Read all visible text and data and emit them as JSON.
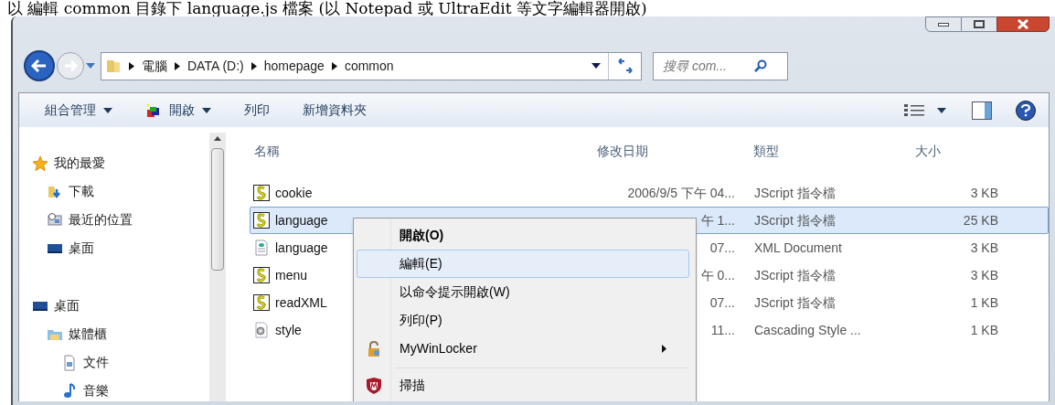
{
  "caption": "以 編輯 common 目錄下 language.js 檔案 (以 Notepad 或 UltraEdit 等文字編輯器開啟)",
  "breadcrumb": [
    "電腦",
    "DATA (D:)",
    "homepage",
    "common"
  ],
  "search": {
    "placeholder": "搜尋 com..."
  },
  "toolbar": [
    {
      "label": "組合管理",
      "dropdown": true,
      "kind": "plain"
    },
    {
      "label": "開啟",
      "dropdown": true,
      "kind": "open"
    },
    {
      "label": "列印",
      "dropdown": false,
      "kind": "plain"
    },
    {
      "label": "新增資料夾",
      "dropdown": false,
      "kind": "plain"
    }
  ],
  "nav": [
    {
      "label": "我的最愛",
      "kind": "star",
      "children": [
        {
          "label": "下載",
          "kind": "download"
        },
        {
          "label": "最近的位置",
          "kind": "recent"
        },
        {
          "label": "桌面",
          "kind": "desktop"
        }
      ]
    },
    {
      "label": "桌面",
      "kind": "desktop",
      "children": [
        {
          "label": "媒體櫃",
          "kind": "library",
          "children": [
            {
              "label": "文件",
              "kind": "doc"
            },
            {
              "label": "音樂",
              "kind": "music"
            }
          ]
        }
      ]
    }
  ],
  "columns": [
    "名稱",
    "修改日期",
    "類型",
    "大小"
  ],
  "rows": [
    {
      "name": "cookie",
      "kind": "js",
      "date": "2006/9/5 下午 04...",
      "type": "JScript 指令檔",
      "size": "3 KB",
      "selected": false
    },
    {
      "name": "language",
      "kind": "js",
      "date": "午 1...",
      "type": "JScript 指令檔",
      "size": "25 KB",
      "selected": true
    },
    {
      "name": "language",
      "kind": "xml",
      "date": "07...",
      "type": "XML Document",
      "size": "3 KB",
      "selected": false
    },
    {
      "name": "menu",
      "kind": "js",
      "date": "午 0...",
      "type": "JScript 指令檔",
      "size": "3 KB",
      "selected": false
    },
    {
      "name": "readXML",
      "kind": "js",
      "date": "07...",
      "type": "JScript 指令檔",
      "size": "1 KB",
      "selected": false
    },
    {
      "name": "style",
      "kind": "css",
      "date": "11...",
      "type": "Cascading Style ...",
      "size": "1 KB",
      "selected": false
    }
  ],
  "context_menu": [
    {
      "label": "開啟(O)",
      "bold": true,
      "selected": false,
      "kind": "item"
    },
    {
      "label": "編輯(E)",
      "bold": false,
      "selected": true,
      "kind": "item"
    },
    {
      "label": "以命令提示開啟(W)",
      "bold": false,
      "selected": false,
      "kind": "item"
    },
    {
      "label": "列印(P)",
      "bold": false,
      "selected": false,
      "kind": "item"
    },
    {
      "label": "MyWinLocker",
      "bold": false,
      "selected": false,
      "kind": "lock",
      "submenu": true
    },
    {
      "label": "掃描",
      "bold": false,
      "selected": false,
      "kind": "shield",
      "separator_before": true
    }
  ]
}
